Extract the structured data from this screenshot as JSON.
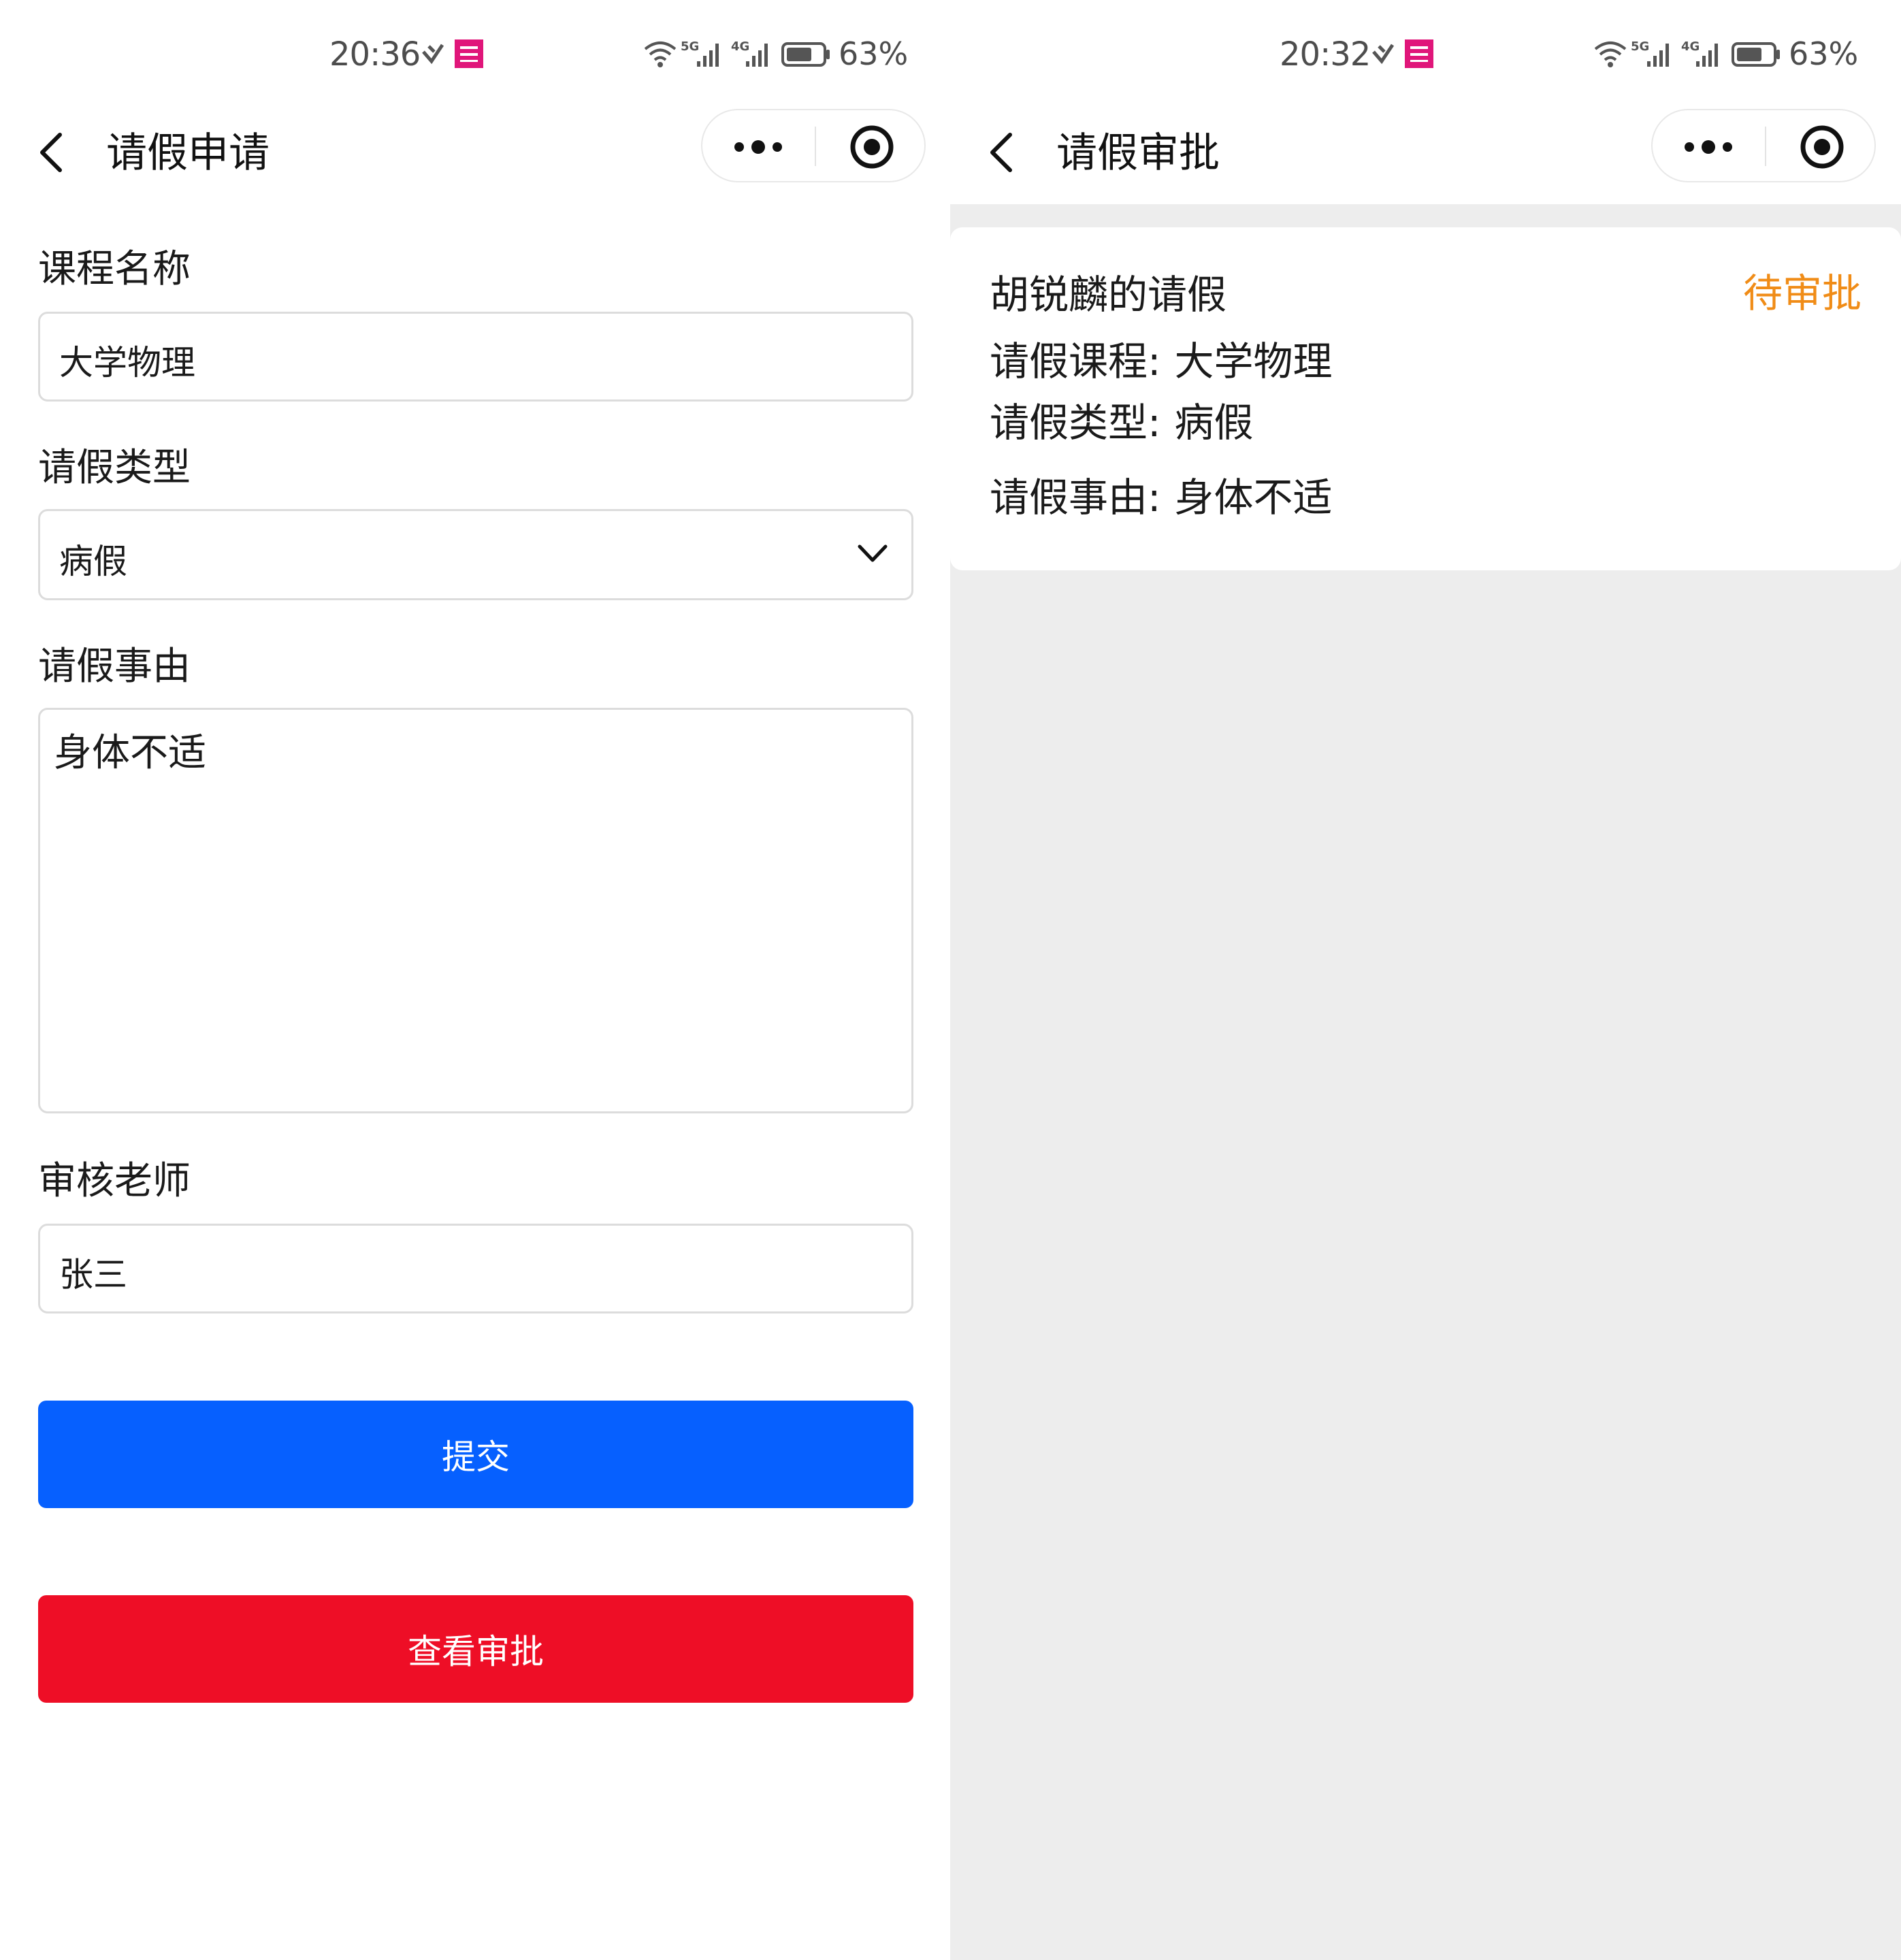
{
  "left": {
    "status_bar": {
      "time": "20:36",
      "battery": "63%",
      "net_a": "5G",
      "net_b": "4G"
    },
    "nav": {
      "title": "请假申请"
    },
    "form": {
      "course_label": "课程名称",
      "course_value": "大学物理",
      "type_label": "请假类型",
      "type_value": "病假",
      "reason_label": "请假事由",
      "reason_value": "身体不适",
      "teacher_label": "审核老师",
      "teacher_value": "张三"
    },
    "buttons": {
      "submit": "提交",
      "view_approval": "查看审批"
    }
  },
  "right": {
    "status_bar": {
      "time": "20:32",
      "battery": "63%",
      "net_a": "5G",
      "net_b": "4G"
    },
    "nav": {
      "title": "请假审批"
    },
    "card": {
      "title": "胡锐麟的请假",
      "status": "待审批",
      "course_label": "请假课程:",
      "course_value": "大学物理",
      "type_label": "请假类型:",
      "type_value": "病假",
      "reason_label": "请假事由:",
      "reason_value": "身体不适"
    }
  },
  "colors": {
    "submit_button": "#0660ff",
    "view_button": "#ee0e26",
    "status_pending": "#f08c17",
    "right_background": "#ededed"
  }
}
